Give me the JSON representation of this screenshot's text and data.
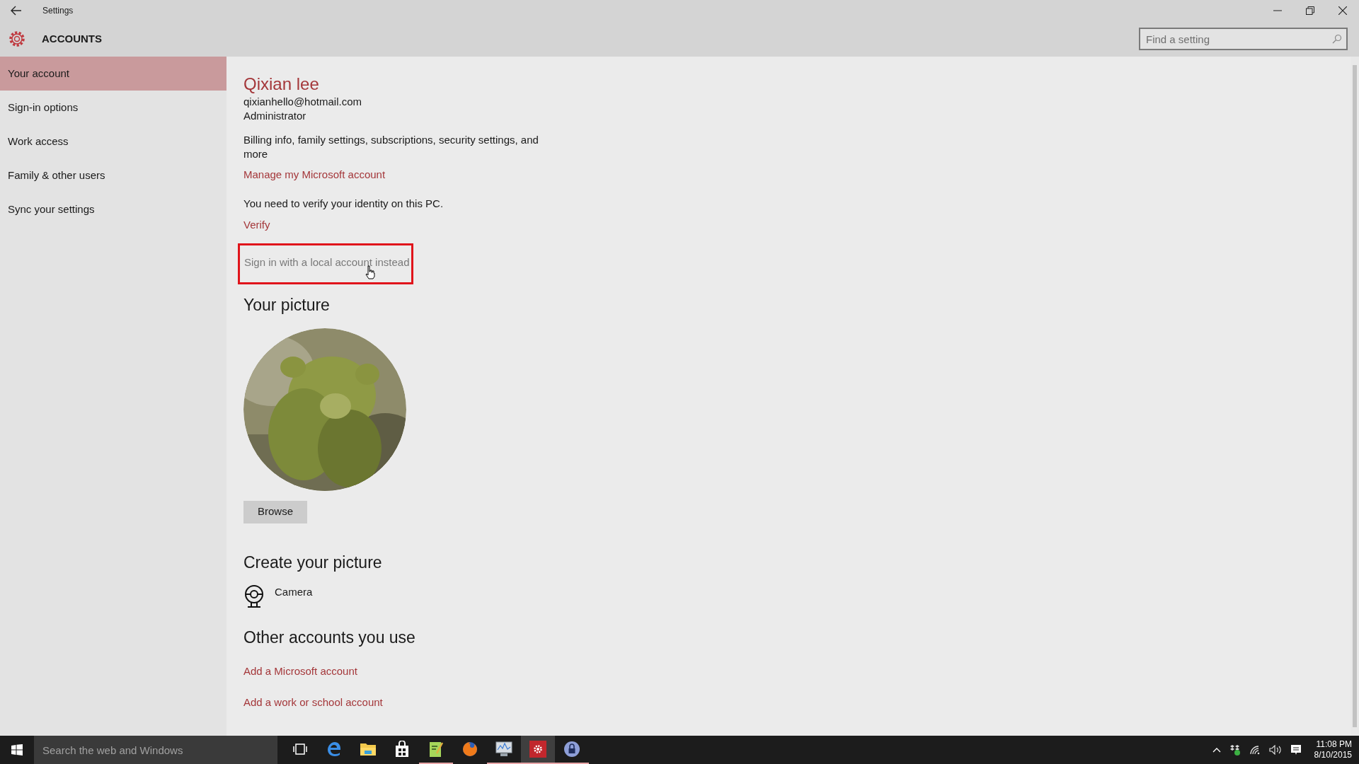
{
  "window": {
    "title": "Settings"
  },
  "header": {
    "title": "ACCOUNTS"
  },
  "search": {
    "placeholder": "Find a setting"
  },
  "sidebar": {
    "items": [
      {
        "label": "Your account",
        "selected": true
      },
      {
        "label": "Sign-in options",
        "selected": false
      },
      {
        "label": "Work access",
        "selected": false
      },
      {
        "label": "Family & other users",
        "selected": false
      },
      {
        "label": "Sync your settings",
        "selected": false
      }
    ]
  },
  "account": {
    "name": "Qixian lee",
    "email": "qixianhello@hotmail.com",
    "role": "Administrator",
    "description": "Billing info, family settings, subscriptions, security settings, and more",
    "manage_link": "Manage my Microsoft account",
    "verify_note": "You need to verify your identity on this PC.",
    "verify_link": "Verify",
    "local_link": {
      "label": "Sign in with a local account instead",
      "highlighted": true
    }
  },
  "your_picture": {
    "heading": "Your picture",
    "browse_button": "Browse"
  },
  "create_picture": {
    "heading": "Create your picture",
    "items": [
      {
        "label": "Camera"
      }
    ]
  },
  "other_accounts": {
    "heading": "Other accounts you use",
    "links": [
      "Add a Microsoft account",
      "Add a work or school account"
    ]
  },
  "taskbar": {
    "search_placeholder": "Search the web and Windows",
    "apps": [
      {
        "kind": "taskview",
        "running": false,
        "selected": false
      },
      {
        "kind": "edge",
        "running": false,
        "selected": false
      },
      {
        "kind": "explorer",
        "running": false,
        "selected": false
      },
      {
        "kind": "store",
        "running": false,
        "selected": false
      },
      {
        "kind": "notepad",
        "running": true,
        "selected": false
      },
      {
        "kind": "firefox",
        "running": false,
        "selected": false
      },
      {
        "kind": "monitor",
        "running": true,
        "selected": false
      },
      {
        "kind": "settings",
        "running": true,
        "selected": true
      },
      {
        "kind": "lock",
        "running": true,
        "selected": false
      }
    ],
    "time": "11:08 PM",
    "date": "8/10/2015"
  }
}
